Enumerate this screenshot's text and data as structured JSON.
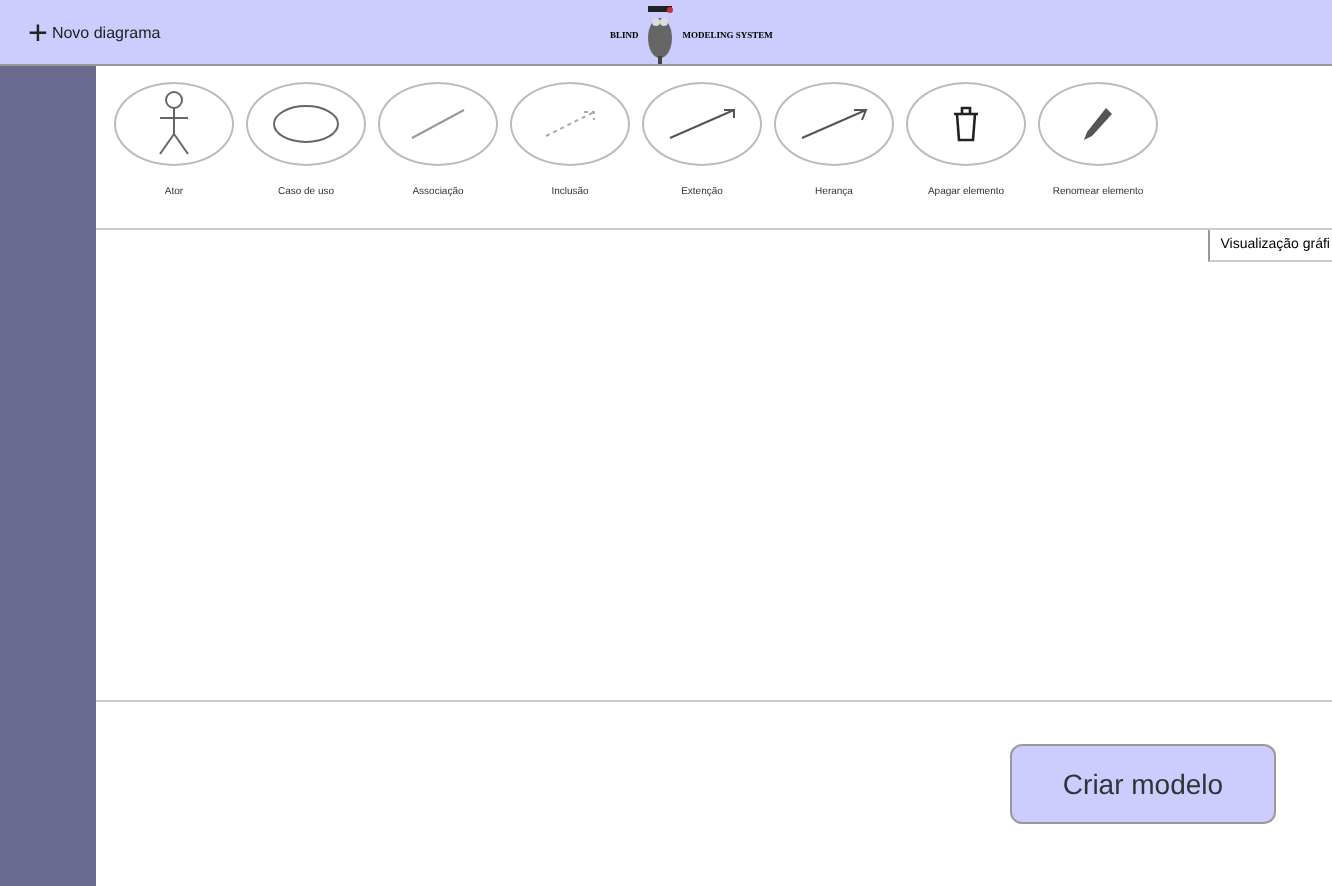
{
  "header": {
    "new_button": {
      "icon": "+",
      "label": "Novo diagrama"
    },
    "logo": {
      "left": "BLIND",
      "right": "MODELING SYSTEM"
    }
  },
  "tools": [
    {
      "kind": "actor",
      "label": "Ator"
    },
    {
      "kind": "usecase",
      "label": "Caso de uso"
    },
    {
      "kind": "association",
      "label": "Associação"
    },
    {
      "kind": "include",
      "label": "Inclusão"
    },
    {
      "kind": "extend",
      "label": "Extenção"
    },
    {
      "kind": "inherit",
      "label": "Herança"
    },
    {
      "kind": "delete",
      "label": "Apagar elemento"
    },
    {
      "kind": "rename",
      "label": "Renomear elemento"
    }
  ],
  "canvas": {
    "tab": "Visualização gráfi"
  },
  "footer": {
    "button": "Criar modelo"
  }
}
